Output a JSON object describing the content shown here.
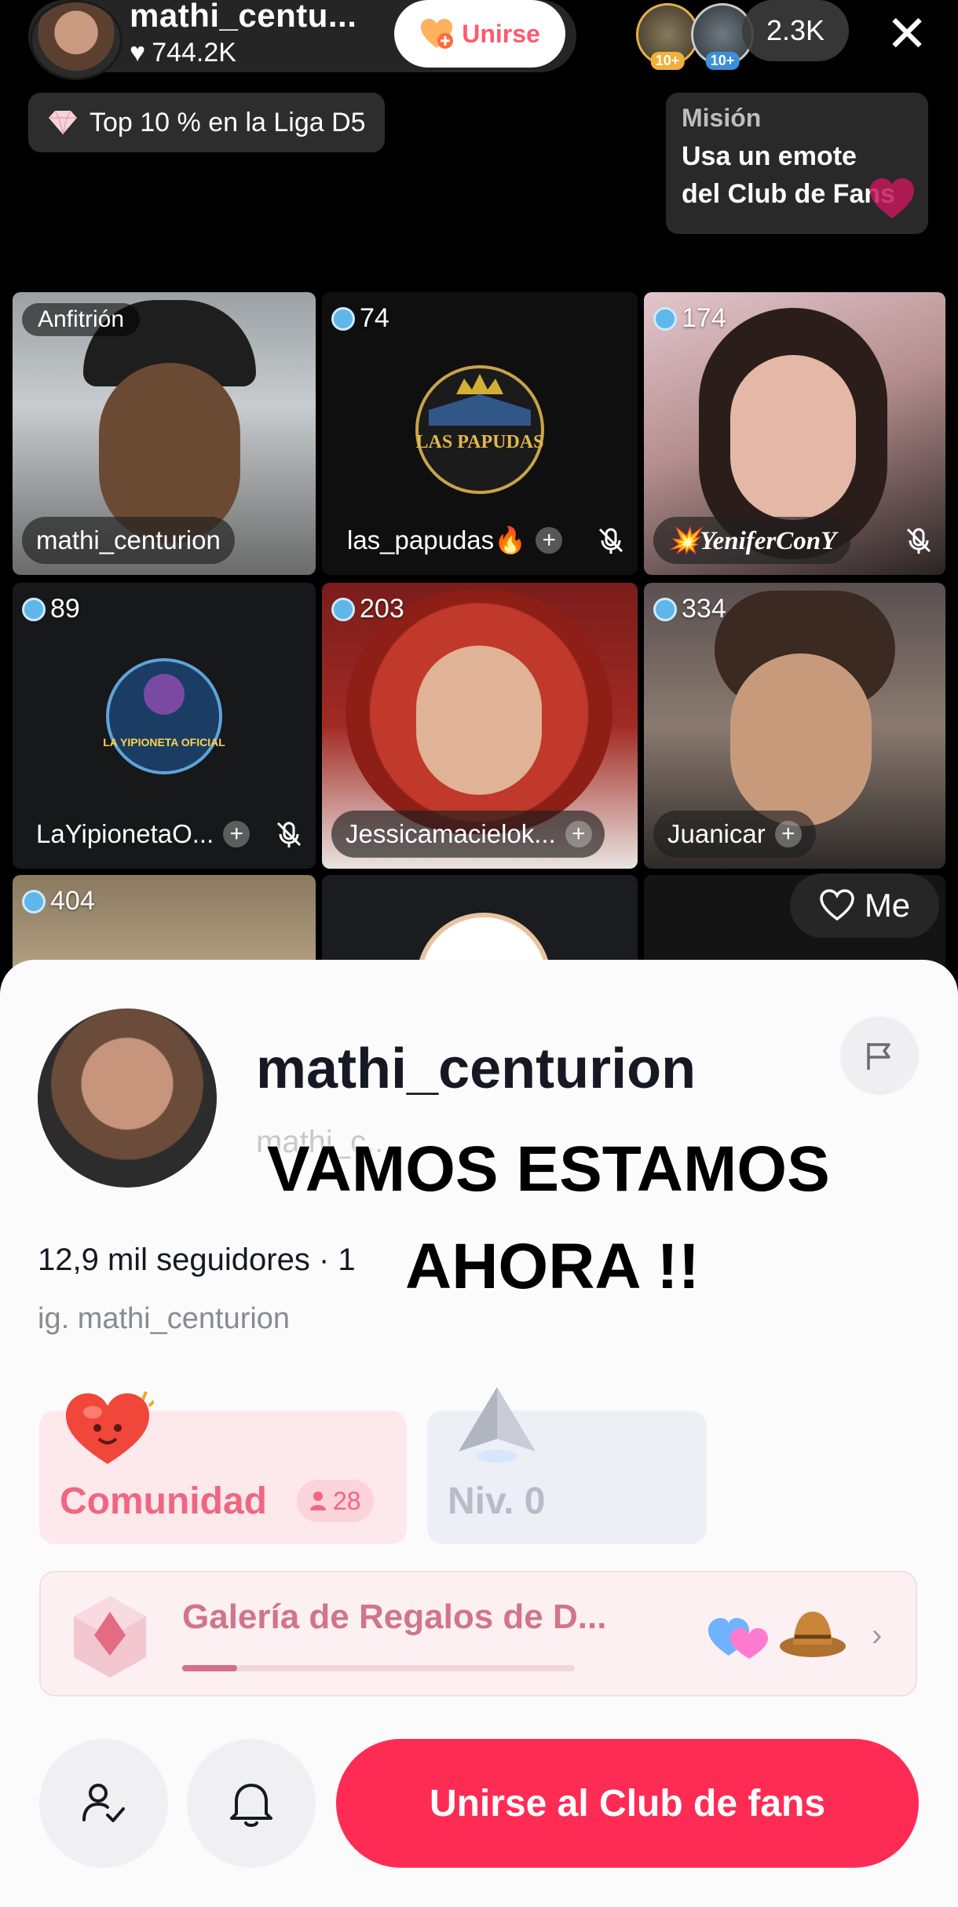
{
  "header": {
    "host_name": "mathi_centu...",
    "host_likes": "744.2K",
    "join_label": "Unirse",
    "viewer_badges": [
      "10+",
      "10+"
    ],
    "viewer_count": "2.3K",
    "close_icon": "close-icon"
  },
  "league": {
    "text": "Top 10 % en la Liga D5"
  },
  "mission": {
    "title": "Misión",
    "text_line1": "Usa un emote",
    "text_line2": "del Club de Fans"
  },
  "grid": {
    "tiles": [
      {
        "tag": "Anfitrión",
        "name": "mathi_centurion"
      },
      {
        "score": "74",
        "name": "las_papudas🔥",
        "logo_text": "LAS PAPUDAS"
      },
      {
        "score": "174",
        "name": "💥YeniferConY"
      },
      {
        "score": "89",
        "name": "LaYipionetaO...",
        "logo_text": "LA YIPIONETA OFICIAL"
      },
      {
        "score": "203",
        "name": "Jessicamacielok..."
      },
      {
        "score": "334",
        "name": "Juanicar"
      },
      {
        "score": "404"
      }
    ],
    "me_label": "Me"
  },
  "profile": {
    "name": "mathi_centurion",
    "handle": "mathi_c...",
    "followers": "12,9 mil seguidores · 1",
    "bio": "ig. mathi_centurion",
    "overlay_line1": "VAMOS ESTAMOS",
    "overlay_line2": "AHORA !!"
  },
  "cards": {
    "community_label": "Comunidad",
    "community_count": "28",
    "level_label": "Niv. 0"
  },
  "gallery": {
    "title": "Galería de Regalos de D...",
    "progress": 0.14
  },
  "actions": {
    "join_club_label": "Unirse al Club de fans"
  },
  "colors": {
    "accent": "#fe2c55",
    "community": "#f06681",
    "gallery_title": "#d17588"
  }
}
